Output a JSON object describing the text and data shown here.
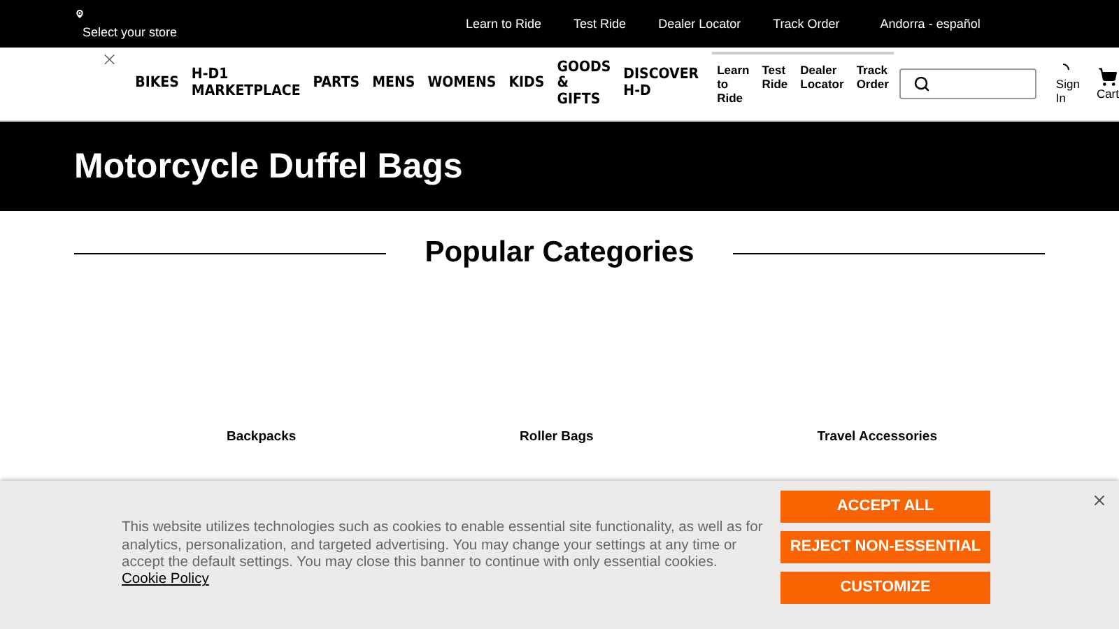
{
  "utility_bar": {
    "store": "Select your store",
    "links": [
      "Learn to Ride",
      "Test Ride",
      "Dealer Locator",
      "Track Order"
    ],
    "locale": "Andorra - español"
  },
  "main_nav": {
    "items": [
      {
        "label": "BIKES",
        "selected": false
      },
      {
        "label": "H-D1 MARKETPLACE",
        "selected": false
      },
      {
        "label": "PARTS",
        "selected": false
      },
      {
        "label": "MENS",
        "selected": false
      },
      {
        "label": "WOMENS",
        "selected": false
      },
      {
        "label": "KIDS",
        "selected": false
      },
      {
        "label": "GOODS & GIFTS",
        "selected": false
      },
      {
        "label": "DISCOVER H-D",
        "selected": false
      }
    ],
    "secondary_links": [
      "Learn to Ride",
      "Test Ride",
      "Dealer Locator",
      "Track Order"
    ],
    "sign_in": "Sign In",
    "cart": "Cart"
  },
  "hero": {
    "title": "Motorcycle Duffel Bags"
  },
  "popular_categories": {
    "heading": "Popular Categories",
    "items": [
      "Backpacks",
      "Roller Bags",
      "Travel Accessories"
    ]
  },
  "cookie_banner": {
    "text": "This website utilizes technologies such as cookies to enable essential site functionality, as well as for analytics, personalization, and targeted advertising. You may change your settings at any time or accept the default settings. You may close this banner to continue with only essential cookies.",
    "link": "Cookie Policy",
    "buttons": [
      "ACCEPT ALL",
      "REJECT NON-ESSENTIAL",
      "CUSTOMIZE"
    ]
  }
}
